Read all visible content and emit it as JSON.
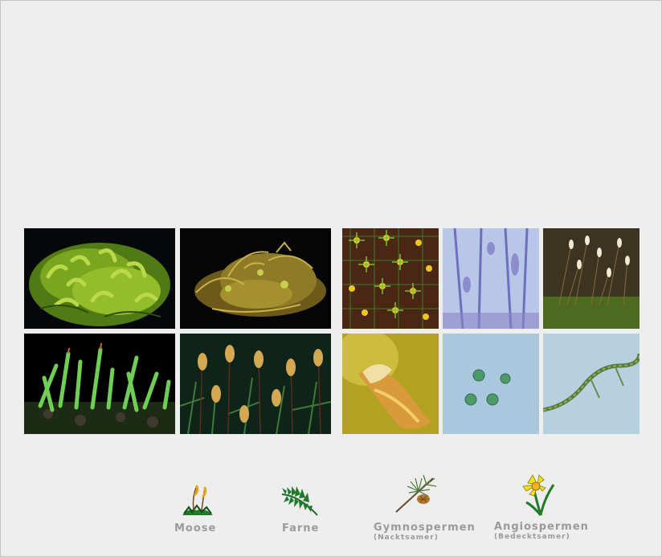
{
  "nav": {
    "items": [
      {
        "id": "moose",
        "label": "Moose",
        "sub": "",
        "icon": "moss-plant-icon"
      },
      {
        "id": "farne",
        "label": "Farne",
        "sub": "",
        "icon": "fern-frond-icon"
      },
      {
        "id": "gymno",
        "label": "Gymnospermen",
        "sub": "(Nacktsamer)",
        "icon": "pine-branch-icon"
      },
      {
        "id": "angio",
        "label": "Angiospermen",
        "sub": "(Bedecktsamer)",
        "icon": "daffodil-flower-icon"
      }
    ]
  },
  "gallery": {
    "thumbnails": [
      "moss-cushion-photo",
      "moss-dry-clump-photo",
      "moss-star-rosettes-photo",
      "moss-cell-micrograph-photo",
      "moss-sporophytes-photo",
      "moss-green-shoots-photo",
      "moss-capsules-photo",
      "moss-capsule-closeup-photo",
      "moss-spores-micrograph-photo",
      "moss-protonema-micrograph-photo"
    ]
  },
  "colors": {
    "background": "#eeeeee",
    "label": "#9a9a9a",
    "border": "#c4c4c4"
  }
}
